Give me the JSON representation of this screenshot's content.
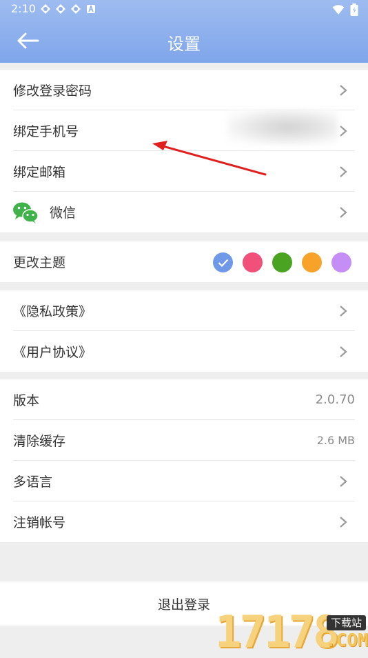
{
  "status_bar": {
    "time": "2:10",
    "notification_icons": [
      "app-notification-icon",
      "app-notification-icon",
      "app-notification-icon",
      "a-notification-icon"
    ],
    "right_icons": [
      "wifi-icon",
      "battery-icon"
    ]
  },
  "header": {
    "back_icon": "arrow-left-icon",
    "title": "设置"
  },
  "account_group": {
    "items": [
      {
        "label": "修改登录密码",
        "icon": "chevron-right-icon"
      },
      {
        "label": "绑定手机号",
        "icon": "chevron-right-icon"
      },
      {
        "label": "绑定邮箱",
        "icon": "chevron-right-icon"
      },
      {
        "label": "微信",
        "leading_icon": "wechat-icon",
        "icon": "chevron-right-icon"
      }
    ]
  },
  "theme_group": {
    "label": "更改主题",
    "swatches": [
      {
        "color": "#6f98e8",
        "selected": true,
        "icon": "checkmark-icon"
      },
      {
        "color": "#f0507a",
        "selected": false
      },
      {
        "color": "#4aa321",
        "selected": false
      },
      {
        "color": "#f9a229",
        "selected": false
      },
      {
        "color": "#c58ef6",
        "selected": false
      }
    ]
  },
  "policy_group": {
    "items": [
      {
        "label": "《隐私政策》",
        "icon": "chevron-right-icon"
      },
      {
        "label": "《用户协议》",
        "icon": "chevron-right-icon"
      }
    ]
  },
  "misc_group": {
    "version_label": "版本",
    "version_value": "2.0.70",
    "cache_label": "清除缓存",
    "cache_value": "2.6 MB",
    "language_label": "多语言",
    "cancel_account_label": "注销帐号"
  },
  "logout_label": "退出登录",
  "watermark": {
    "digits": "17178",
    "badge": "下载站",
    "domain": ".COM"
  },
  "colors": {
    "header_top": "#9ebcf0",
    "header_bottom": "#7fa5ea",
    "annotation_arrow": "#e01f1f"
  }
}
